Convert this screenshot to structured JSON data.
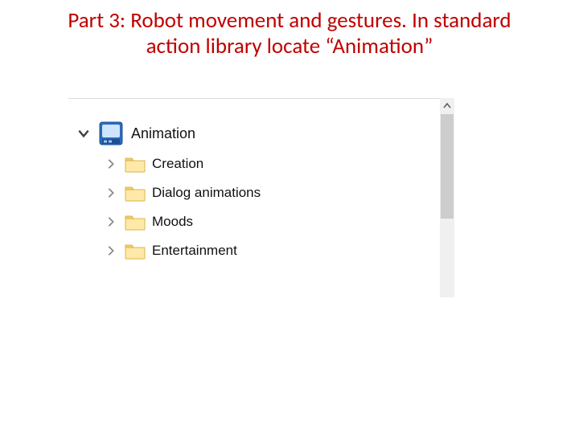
{
  "title": {
    "line1": "Part 3: Robot movement and gestures.  In standard",
    "line2": "action library locate “Animation”"
  },
  "tree": {
    "root": {
      "label": "Animation",
      "expanded": true
    },
    "children": [
      {
        "label": "Creation",
        "expanded": false
      },
      {
        "label": "Dialog animations",
        "expanded": false
      },
      {
        "label": "Moods",
        "expanded": false
      },
      {
        "label": "Entertainment",
        "expanded": false
      }
    ]
  },
  "icons": {
    "root": "animation-box-icon",
    "folder": "folder-icon",
    "chevron_down": "chevron-down-icon",
    "chevron_right": "chevron-right-icon",
    "scroll_up": "scroll-up-icon"
  }
}
